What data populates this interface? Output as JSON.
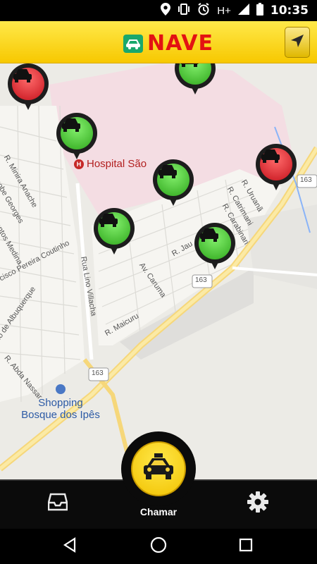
{
  "status_bar": {
    "network_label": "H+",
    "time": "10:35"
  },
  "header": {
    "title": "NAVE",
    "logo_icon": "taxi-logo-icon",
    "locate_icon": "navigation-arrow-icon"
  },
  "map": {
    "hospital": "Hospital São",
    "hospital_suffix": "o",
    "shopping_line1": "Shopping",
    "shopping_line2": "Bosque dos Ipês",
    "streets": {
      "minira": "R. Minira Anache",
      "jacobe": "Jacobe Georges",
      "santos": "Santos Medina",
      "cisco": "cisco Pereira Coutinho",
      "lino": "Rua Lino Villacha",
      "albuquerque": "rimo de Albuquerque",
      "caruma": "Av. Caruma",
      "maicuru": "R. Maicuru",
      "abda": "R. Abda Nassar",
      "jau": "R. Jau",
      "carabinari": "R. Carabinari",
      "catrimani": "R. Catrimani",
      "uruana": "R. Uruanã"
    },
    "shield_163": "163",
    "pins": [
      {
        "status": "available",
        "color": "#2fa71c"
      },
      {
        "status": "busy",
        "color": "#c5121c"
      },
      {
        "status": "available",
        "color": "#2fa71c"
      },
      {
        "status": "available",
        "color": "#2fa71c"
      },
      {
        "status": "available",
        "color": "#2fa71c"
      },
      {
        "status": "available",
        "color": "#2fa71c"
      },
      {
        "status": "busy",
        "color": "#c5121c"
      }
    ]
  },
  "bottom_bar": {
    "call_label": "Chamar",
    "inbox_icon": "inbox-icon",
    "settings_icon": "gear-icon"
  },
  "colors": {
    "accent": "#f7c800",
    "brand_red": "#e31212",
    "available": "#2fa71c",
    "busy": "#c5121c"
  }
}
